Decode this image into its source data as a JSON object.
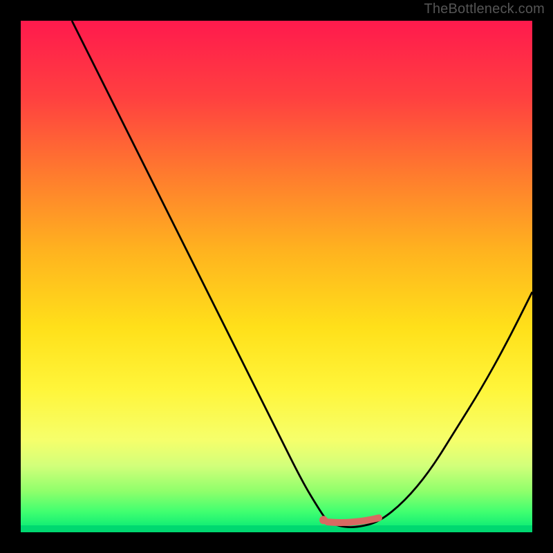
{
  "watermark": "TheBottleneck.com",
  "colors": {
    "curve": "#000000",
    "marker_line": "#d86a62",
    "marker_point": "#d86a62",
    "gradient_top": "#ff1a4d",
    "gradient_bottom": "#00e676",
    "frame": "#000000"
  },
  "chart_data": {
    "type": "line",
    "title": "",
    "xlabel": "",
    "ylabel": "",
    "xlim": [
      0,
      100
    ],
    "ylim": [
      0,
      100
    ],
    "grid": false,
    "legend": false,
    "series": [
      {
        "name": "bottleneck-curve",
        "x": [
          10,
          15,
          20,
          25,
          30,
          35,
          40,
          45,
          50,
          55,
          58,
          60,
          63,
          66,
          70,
          75,
          80,
          85,
          90,
          95,
          100
        ],
        "y": [
          100,
          90,
          80,
          70,
          60,
          50,
          40,
          30,
          20,
          10,
          5,
          2,
          1,
          1,
          2,
          6,
          12,
          20,
          28,
          37,
          47
        ]
      }
    ],
    "optimal_range": {
      "x_start": 60,
      "x_end": 70,
      "y": 1
    },
    "annotations": []
  }
}
